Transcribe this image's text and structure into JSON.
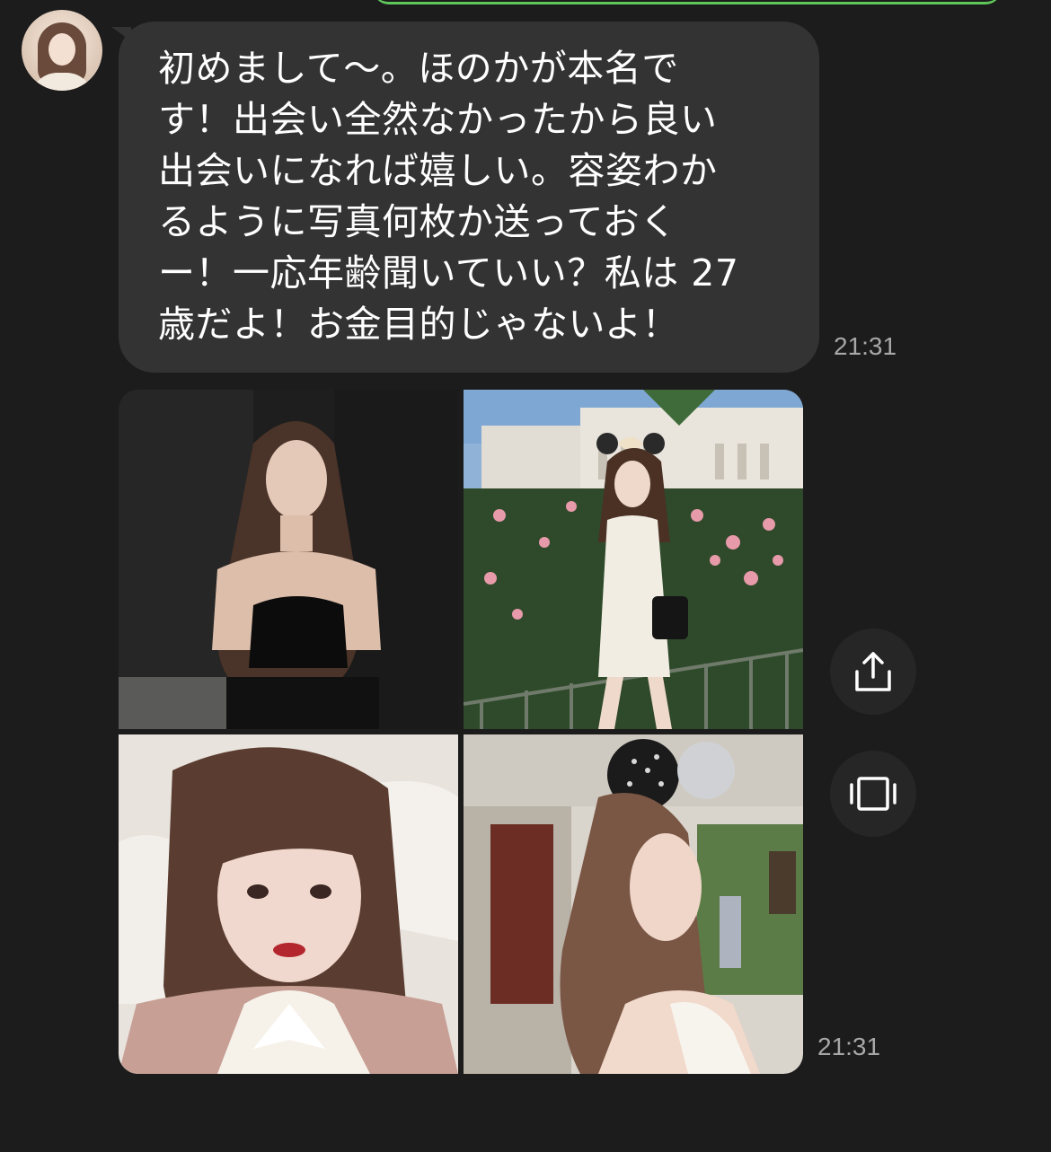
{
  "chat": {
    "sender_avatar": "profile photo",
    "message": {
      "lines": [
        "初めまして〜。ほのかが本名で",
        "す！出会い全然なかったから良い",
        "出会いになれば嬉しい。容姿わか",
        "るように写真何枚か送っておく",
        "ー！一応年齢聞いていい？私は 27",
        "歳だよ！お金目的じゃないよ！"
      ],
      "time": "21:31"
    },
    "photo_group": {
      "photo_count": 4,
      "time": "21:31",
      "actions": [
        {
          "icon": "share-icon"
        },
        {
          "icon": "album-icon"
        }
      ]
    }
  },
  "colors": {
    "background": "#1c1c1c",
    "bubble": "#333333",
    "text": "#ffffff",
    "timestamp": "#a7a7a7",
    "outgoing_accent": "#5ec85a"
  }
}
